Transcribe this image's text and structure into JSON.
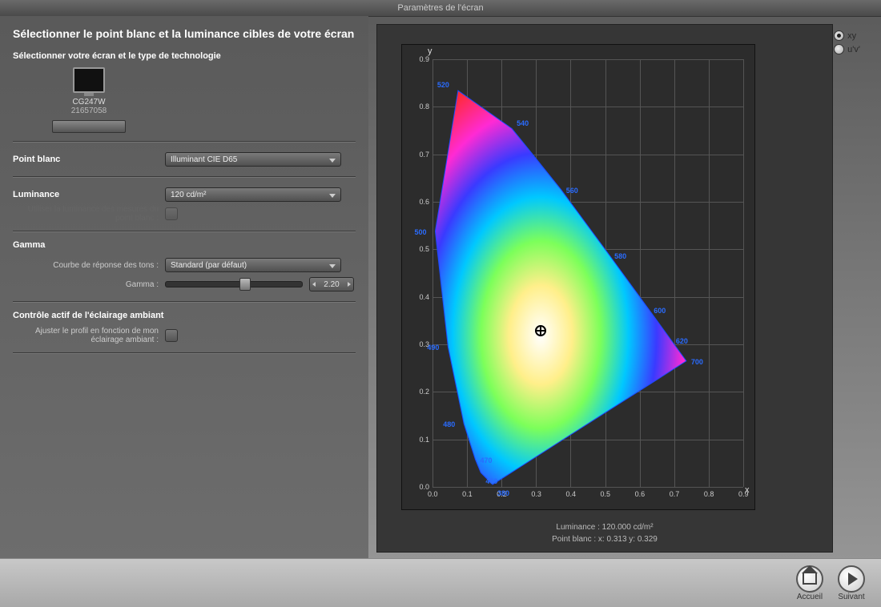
{
  "window_title": "Paramètres de l'écran",
  "heading": "Sélectionner le point blanc et la luminance cibles de votre écran",
  "tech_heading": "Sélectionner votre écran et le type de technologie",
  "monitor": {
    "name": "CG247W",
    "serial": "21657058"
  },
  "whitepoint": {
    "label": "Point blanc",
    "value": "Illuminant CIE D65"
  },
  "luminance": {
    "label": "Luminance",
    "value": "120 cd/m²",
    "use_measured_label": "Utiliser la luminance des mesures du point blanc :"
  },
  "gamma": {
    "section": "Gamma",
    "tonecurve_label": "Courbe de réponse des tons :",
    "tonecurve_value": "Standard (par défaut)",
    "gamma_label": "Gamma :",
    "gamma_value": "2.20"
  },
  "alc": {
    "section": "Contrôle actif de l'éclairage ambiant",
    "adjust_label": "Ajuster le profil en fonction de mon éclairage ambiant :"
  },
  "coord_modes": {
    "xy": "xy",
    "uv": "u'v'"
  },
  "chart_info": {
    "luminance": "Luminance : 120.000 cd/m²",
    "whitepoint": "Point blanc : x: 0.313  y: 0.329"
  },
  "chart_data": {
    "type": "scatter",
    "title": "",
    "xlabel": "x",
    "ylabel": "y",
    "xlim": [
      0.0,
      0.9
    ],
    "ylim": [
      0.0,
      0.9
    ],
    "x_ticks": [
      "0.0",
      "0.1",
      "0.2",
      "0.3",
      "0.4",
      "0.5",
      "0.6",
      "0.7",
      "0.8",
      "0.9"
    ],
    "y_ticks": [
      "0.0",
      "0.1",
      "0.2",
      "0.3",
      "0.4",
      "0.5",
      "0.6",
      "0.7",
      "0.8",
      "0.9"
    ],
    "grid": true,
    "white_point": {
      "x": 0.313,
      "y": 0.329
    },
    "spectral_locus": [
      {
        "nm": 380,
        "x": 0.174,
        "y": 0.005
      },
      {
        "nm": 460,
        "x": 0.14,
        "y": 0.03
      },
      {
        "nm": 470,
        "x": 0.124,
        "y": 0.058
      },
      {
        "nm": 480,
        "x": 0.091,
        "y": 0.133
      },
      {
        "nm": 490,
        "x": 0.045,
        "y": 0.295
      },
      {
        "nm": 500,
        "x": 0.008,
        "y": 0.538
      },
      {
        "nm": 520,
        "x": 0.074,
        "y": 0.834
      },
      {
        "nm": 540,
        "x": 0.23,
        "y": 0.754
      },
      {
        "nm": 560,
        "x": 0.373,
        "y": 0.625
      },
      {
        "nm": 580,
        "x": 0.513,
        "y": 0.487
      },
      {
        "nm": 600,
        "x": 0.627,
        "y": 0.373
      },
      {
        "nm": 620,
        "x": 0.691,
        "y": 0.309
      },
      {
        "nm": 700,
        "x": 0.735,
        "y": 0.265
      }
    ]
  },
  "footer": {
    "home": "Accueil",
    "next": "Suivant"
  }
}
